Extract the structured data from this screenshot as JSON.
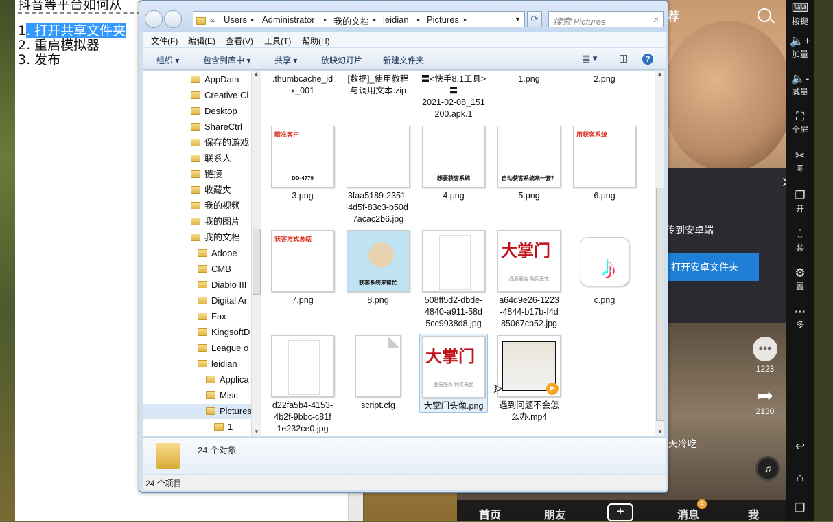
{
  "notepad": {
    "line0": "抖音等平台如何从",
    "line1_num": "1",
    "line1_sel": ". 打开共享文件夹",
    "line2": "2. 重启模拟器",
    "line3": "3. 发布"
  },
  "explorer": {
    "address": [
      "«",
      "Users",
      "▸",
      "Administrator",
      "▸",
      "我的文档",
      "▸",
      "leidian",
      "▸",
      "Pictures",
      "▸"
    ],
    "search_placeholder": "搜索 Pictures",
    "menu": [
      "文件(F)",
      "编辑(E)",
      "查看(V)",
      "工具(T)",
      "帮助(H)"
    ],
    "cmd": [
      "组织 ▾",
      "包含到库中 ▾",
      "共享 ▾",
      "放映幻灯片",
      "新建文件夹"
    ],
    "nav": [
      "AppData",
      "Creative Cl",
      "Desktop",
      "ShareCtrl",
      "保存的游戏",
      "联系人",
      "链接",
      "收藏夹",
      "我的视频",
      "我的图片",
      "我的文档",
      "Adobe",
      "CMB",
      "Diablo III",
      "Digital Ar",
      "Fax",
      "KingsoftD",
      "League o",
      "leidian",
      "Applica",
      "Misc",
      "Pictures",
      "1"
    ],
    "files_top": [
      ".thumbcache_id\nx_001",
      "[数据]_使用教程\n与调用文本.zip",
      "〓<快手8.1工具>\n〓\n2021-02-08_151\n200.apk.1",
      "1.png",
      "2.png"
    ],
    "files_row1": [
      "3.png",
      "3faa5189-2351-\n4d5f-83c3-b50d\n7acac2b6.jpg",
      "4.png",
      "5.png",
      "6.png"
    ],
    "files_row2": [
      "7.png",
      "8.png",
      "508ff5d2-dbde-\n4840-a911-58d\n5cc9938d8.jpg",
      "a64d9e26-1223\n-4844-b17b-f4d\n85067cb52.jpg",
      "c.png"
    ],
    "files_row3": [
      "d22fa5b4-4153-\n4b2f-9bbc-c81f\n1e232ce0.jpg",
      "script.cfg",
      "大掌门头像.png",
      "遇到问题不会怎\n么办.mp4"
    ],
    "meme_texts": {
      "m3": "精准客户",
      "m3b": "DD-4779",
      "m4": "想要获客系统",
      "m5": "自动获客系统来一套？",
      "m6": "用获客系统",
      "m7": "获客方式总结",
      "m8": "获客系统来帮忙"
    },
    "brand_text": "大掌门",
    "brand_sub": "品质服务 购买无忧",
    "tiktok_glyph": "♪",
    "details_count": "24 个对象",
    "status": "24 个项目"
  },
  "phone": {
    "top_tab": "荐",
    "dialog_msg": "传到安卓端",
    "dialog_btn": "打开安卓文件夹",
    "likes": "1223",
    "shares": "2130",
    "caption": "#天冷吃",
    "nav": [
      "首页",
      "朋友",
      "+",
      "消息",
      "我"
    ],
    "msg_badge": "4"
  },
  "sidebar": [
    {
      "label": "按键"
    },
    {
      "label": "加量"
    },
    {
      "label": "减量"
    },
    {
      "label": "全屏"
    },
    {
      "label": "图"
    },
    {
      "label": "开"
    },
    {
      "label": "装"
    },
    {
      "label": "置"
    },
    {
      "label": "多"
    }
  ]
}
